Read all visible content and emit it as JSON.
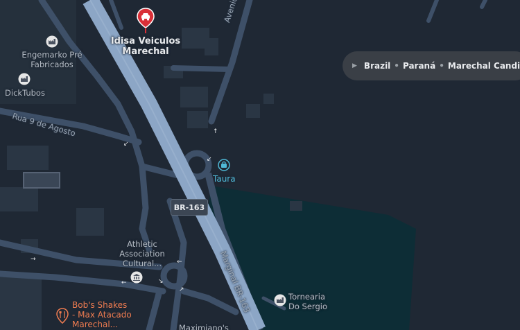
{
  "breadcrumb": {
    "items": [
      "Brazil",
      "Paraná",
      "Marechal Candido Rondon"
    ],
    "separator": "•",
    "expand_icon": "triangle-right-icon"
  },
  "places": {
    "idisa": {
      "line1": "Idisa Veiculos",
      "line2": "Marechal",
      "icon": "car-pin-icon",
      "color": "#d93038"
    },
    "engemarko": {
      "line1": "Engemarko Pré",
      "line2": "Fabricados",
      "icon": "factory-icon"
    },
    "dicktubos": {
      "line1": "DickTubos",
      "icon": "factory-icon"
    },
    "taura": {
      "line1": "Taura",
      "icon": "bag-icon",
      "color": "#4fb8d6"
    },
    "athletic": {
      "line1": "Athletic",
      "line2": "Association",
      "line3": "Cultural...",
      "icon": "landmark-icon"
    },
    "bobs": {
      "line1": "Bob's Shakes",
      "line2": "- Max Atacado",
      "line3": "Marechal...",
      "icon": "restaurant-icon",
      "color": "#f07c50"
    },
    "tornearia": {
      "line1": "Tornearia",
      "line2": "Do Sergio",
      "icon": "factory-icon"
    },
    "maximiano": {
      "line1": "Maximiano's"
    }
  },
  "roads": {
    "avenida_irio": "Avenida Irio",
    "rua_9": "Rua 9 de Agosto",
    "marginal": "Marginal BR-163",
    "shield": "BR-163"
  },
  "colors": {
    "background": "#1f2834",
    "road": "#3e5068",
    "highway": "#8ca6c6",
    "water": "#0d2d36",
    "building": "#2a3644"
  }
}
